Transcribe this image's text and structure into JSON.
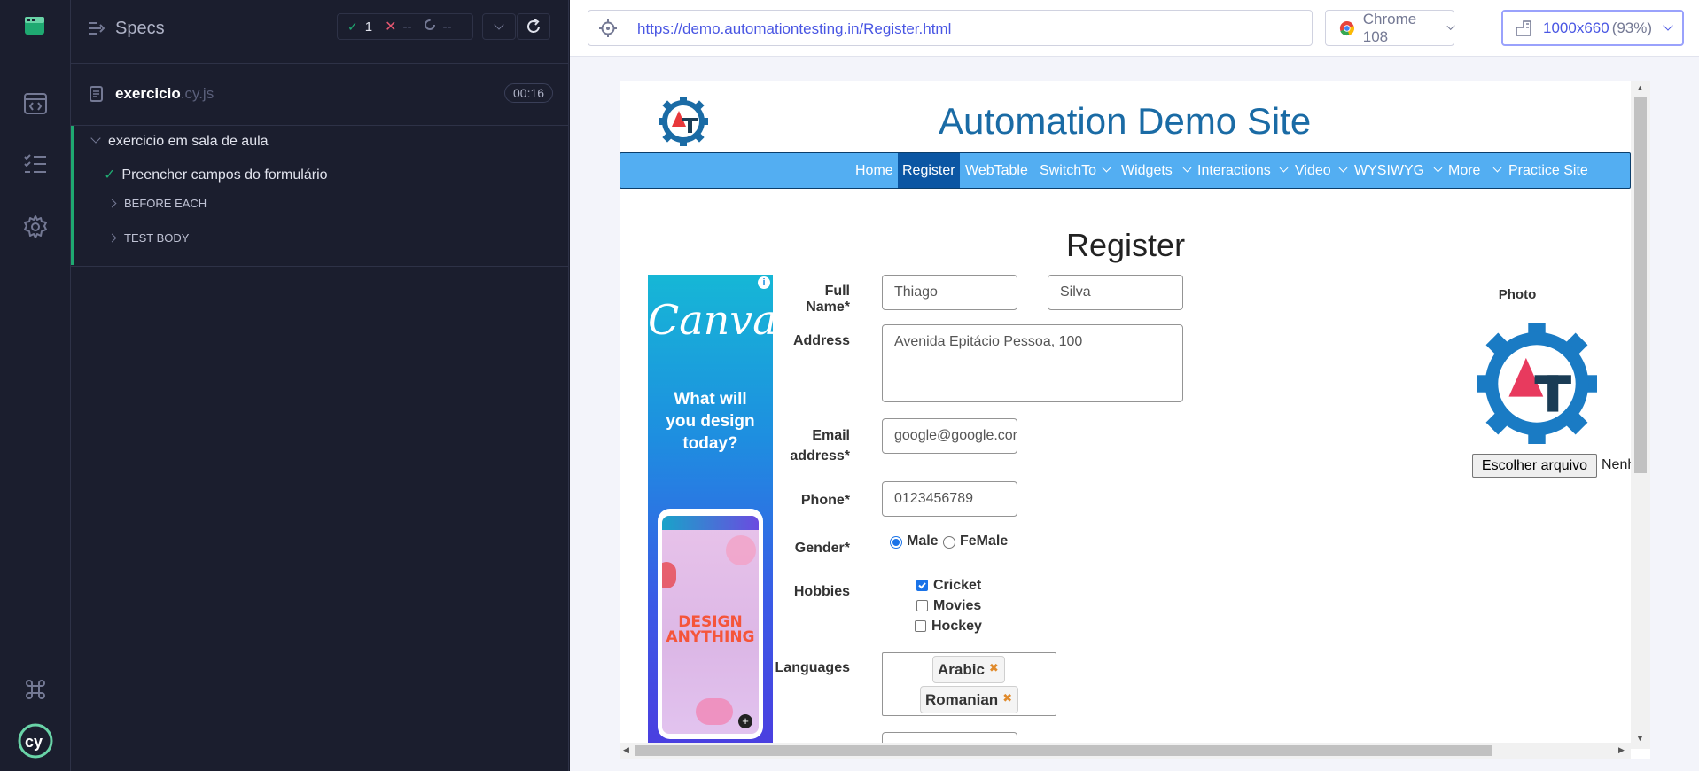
{
  "runner": {
    "header_label": "Specs",
    "passed_count": "1",
    "failed_count": "--",
    "pending_count": "--",
    "spec_file": "exercicio",
    "spec_ext": ".cy.js",
    "duration": "00:16",
    "suite_title": "exercicio em sala de aula",
    "test_title": "Preencher campos do formulário",
    "hook_before_each": "BEFORE EACH",
    "hook_test_body": "TEST BODY"
  },
  "aut": {
    "url": "https://demo.automationtesting.in/Register.html",
    "browser": "Chrome 108",
    "viewport": "1000x660",
    "viewport_scale": "(93%)"
  },
  "site": {
    "title": "Automation Demo Site",
    "nav": [
      "Home",
      "Register",
      "WebTable",
      "SwitchTo",
      "Widgets",
      "Interactions",
      "Video",
      "WYSIWYG",
      "More",
      "Practice Site"
    ],
    "active_nav": "Register",
    "form_title": "Register",
    "labels": {
      "full_name": "Full Name*",
      "address": "Address",
      "email_1": "Email",
      "email_2": "address*",
      "phone": "Phone*",
      "gender": "Gender*",
      "hobbies": "Hobbies",
      "languages": "Languages",
      "photo": "Photo"
    },
    "values": {
      "first_name": "Thiago",
      "last_name": "Silva",
      "address": "Avenida Epitácio Pessoa, 100",
      "email": "google@google.com",
      "phone": "0123456789"
    },
    "gender_options": [
      "Male",
      "FeMale"
    ],
    "gender_selected": "Male",
    "hobbies": [
      {
        "label": "Cricket",
        "checked": true
      },
      {
        "label": "Movies",
        "checked": false
      },
      {
        "label": "Hockey",
        "checked": false
      }
    ],
    "languages_selected": [
      "Arabic",
      "Romanian"
    ],
    "choose_file_label": "Escolher arquivo",
    "no_file_text": "Nenh"
  },
  "ad": {
    "brand": "Canva",
    "copy_1": "What will",
    "copy_2": "you design",
    "copy_3": "today?",
    "phone_text_1": "DESIGN",
    "phone_text_2": "ANYTHING"
  },
  "colors": {
    "runner_bg": "#1b1e2e",
    "pass_green": "#1fa971",
    "fail_red": "#e45770",
    "accent_indigo": "#4956e3",
    "site_title_blue": "#1a6ba5",
    "navbar_blue": "#53aef2",
    "nav_active": "#0b56a3"
  }
}
